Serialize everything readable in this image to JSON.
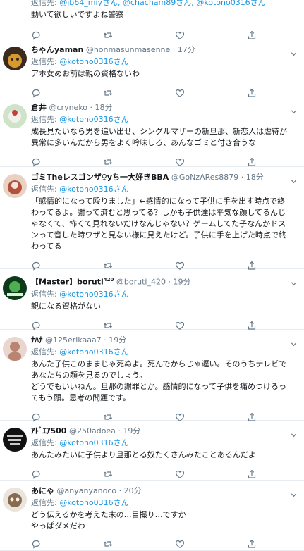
{
  "tweets": [
    {
      "partial": true,
      "reply_label": "返信先: ",
      "mentions": "@jb64_miyさん, @chacham89さん, @kotono0316さん",
      "text": "動いて欲しいですよね警察"
    },
    {
      "name": "ちゃんyaman",
      "handle": "@honmasunmasenne",
      "time": "17分",
      "reply_label": "返信先: ",
      "mentions": "@kotono0316さん",
      "text": "アホ女めお前は親の資格ないわ",
      "avatar_colors": [
        "#3b2b1f",
        "#d89a2c"
      ]
    },
    {
      "name": "倉井",
      "handle": "@cryneko",
      "time": "18分",
      "reply_label": "返信先: ",
      "mentions": "@kotono0316さん",
      "text": "成長見たいなら男を追い出せ、シングルマザーの新旦那、新恋人は虐待が異常に多いんだから男をよく吟味しろ、あんなゴミと付き合うな",
      "avatar_colors": [
        "#cfe3c8",
        "#c0413a"
      ]
    },
    {
      "name": "ゴミTheレスゴンザ♀yち一大好きBBA",
      "handle": "@GoNzARes8879",
      "time": "18分",
      "reply_label": "返信先: ",
      "mentions": "@kotono0316さん",
      "text": "「感情的になって殴りました」←感情的になって子供に手を出す時点で終わってるよ。謝って済むと思ってる？しかも子供達は平気な顔してるんじゃなくて、怖くて見れないだけなんじゃない？ゲームしてた子なんかドスンって音した時ワザと見ない様に見えたけど。子供に手を上げた時点で終わってる",
      "avatar_colors": [
        "#e8d2c4",
        "#b3523c"
      ]
    },
    {
      "name": "【Master】boruti",
      "name_sup": "420",
      "handle": "@boruti_420",
      "time": "19分",
      "reply_label": "返信先: ",
      "mentions": "@kotono0316さん",
      "text": "親になる資格がない",
      "avatar_colors": [
        "#0d3b1a",
        "#4caf50"
      ]
    },
    {
      "name": "ﾅﾊﾅ",
      "handle": "@125erikaaa7",
      "time": "19分",
      "reply_label": "返信先: ",
      "mentions": "@kotono0316さん",
      "text": "あんた子供このままじゃ死ぬよ。死んでからじゃ遅い。そのうちテレビであなたちの顔を見るのでしょう。\nどうでもいいねん。旦那の謝罪とか。感情的になって子供を痛めつけるってもう頭。思考の問題です。",
      "avatar_colors": [
        "#e9d6cf",
        "#b98470"
      ]
    },
    {
      "name": "ｱﾄﾞｴｱ500",
      "handle": "@250adoea",
      "time": "19分",
      "reply_label": "返信先: ",
      "mentions": "@kotono0316さん",
      "text": "あんたみたいに子供より旦那とる奴たくさんみたことあるんだよ",
      "avatar_colors": [
        "#111111",
        "#c8c8c8"
      ]
    },
    {
      "name": "あにゃ",
      "handle": "@anyanyanoco",
      "time": "20分",
      "reply_label": "返信先: ",
      "mentions": "@kotono0316さん",
      "text": "どう伝えるかを考えた末の…目撮り…ですか\nやっぱダメだわ",
      "avatar_colors": [
        "#e9e4dc",
        "#8a6a4f"
      ]
    }
  ],
  "colors": {
    "text": "#14171a",
    "secondary": "#657786",
    "link": "#1b95e0",
    "border": "#e6ecf0"
  },
  "icons": [
    "reply-icon",
    "retweet-icon",
    "like-icon",
    "share-icon",
    "chevron-down-icon"
  ]
}
